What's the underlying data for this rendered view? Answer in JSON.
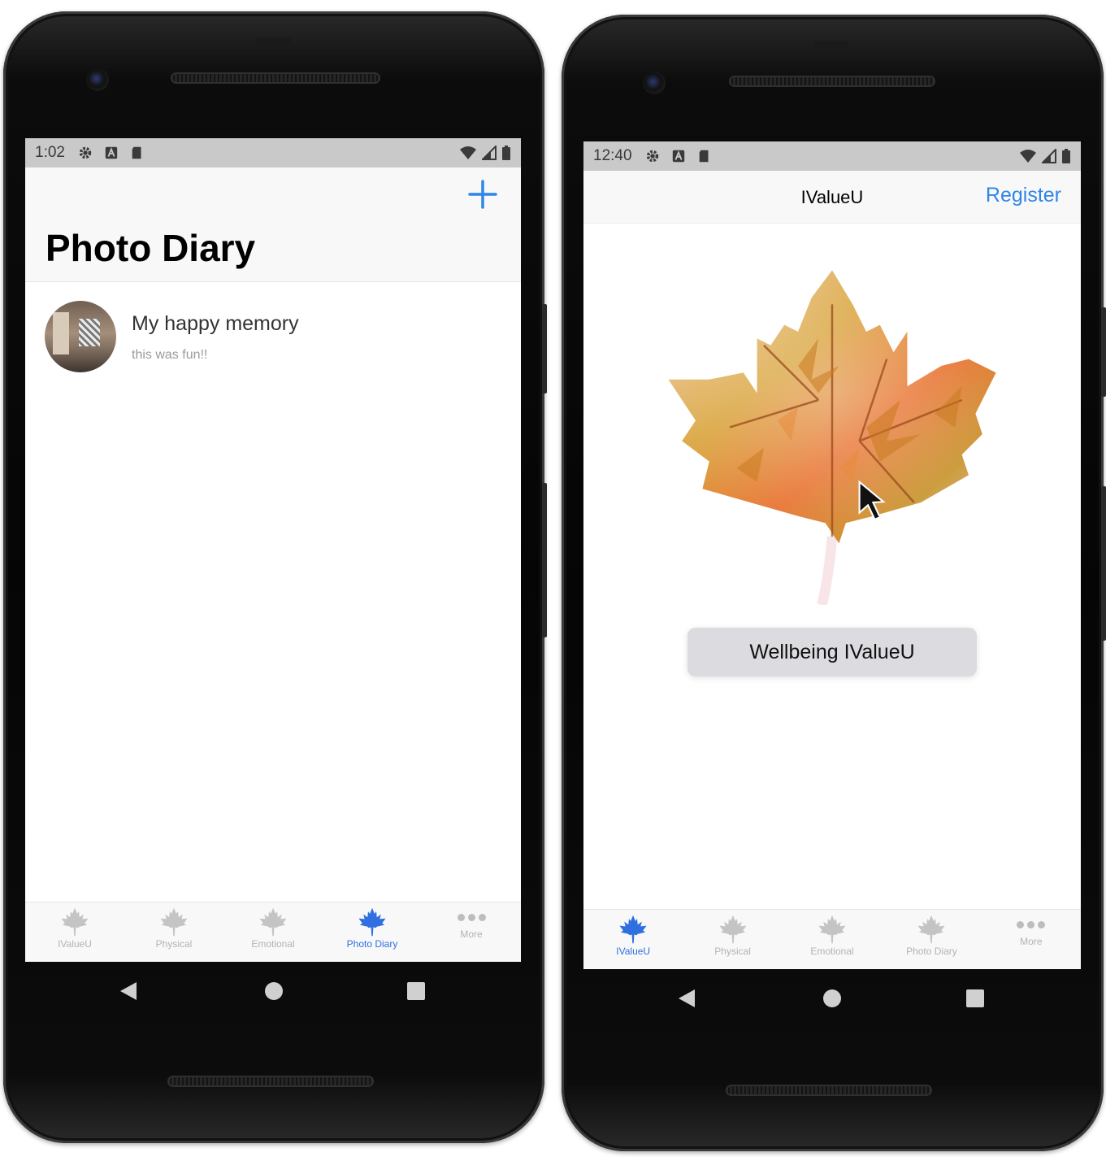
{
  "left_phone": {
    "status": {
      "time": "1:02"
    },
    "header": {
      "title": "Photo Diary",
      "add_icon": "plus-icon"
    },
    "entries": [
      {
        "title": "My happy memory",
        "subtitle": "this was fun!!"
      }
    ],
    "tabs": [
      {
        "label": "IValueU",
        "icon": "maple-leaf-icon",
        "active": false
      },
      {
        "label": "Physical",
        "icon": "maple-leaf-icon",
        "active": false
      },
      {
        "label": "Emotional",
        "icon": "maple-leaf-icon",
        "active": false
      },
      {
        "label": "Photo Diary",
        "icon": "maple-leaf-icon",
        "active": true
      },
      {
        "label": "More",
        "icon": "ellipsis-icon",
        "active": false
      }
    ]
  },
  "right_phone": {
    "status": {
      "time": "12:40"
    },
    "header": {
      "title": "IValueU",
      "action": "Register"
    },
    "main": {
      "button_label": "Wellbeing IValueU"
    },
    "tabs": [
      {
        "label": "IValueU",
        "icon": "maple-leaf-icon",
        "active": true
      },
      {
        "label": "Physical",
        "icon": "maple-leaf-icon",
        "active": false
      },
      {
        "label": "Emotional",
        "icon": "maple-leaf-icon",
        "active": false
      },
      {
        "label": "Photo Diary",
        "icon": "maple-leaf-icon",
        "active": false
      },
      {
        "label": "More",
        "icon": "ellipsis-icon",
        "active": false
      }
    ]
  },
  "colors": {
    "accent": "#2f6fe0",
    "link": "#2f86e6",
    "inactive": "#b3b3b3",
    "status_bar": "#c9c9c9"
  }
}
